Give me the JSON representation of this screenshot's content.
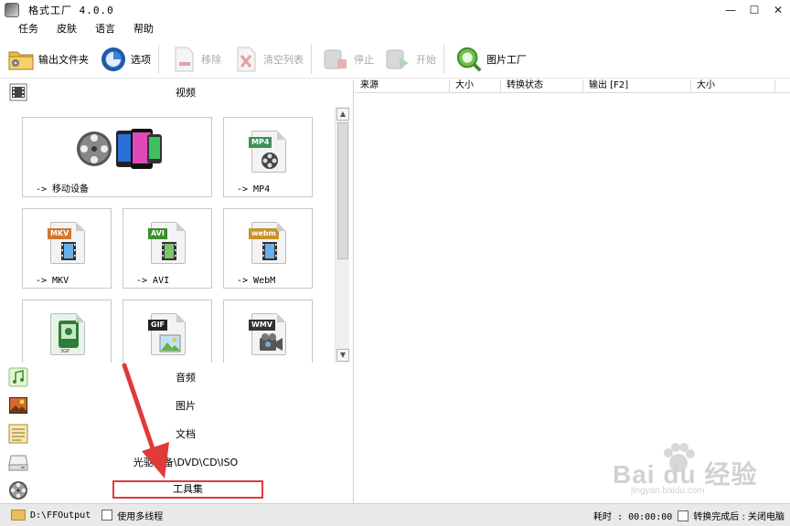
{
  "window": {
    "title": "格式工厂 4.0.0"
  },
  "menu": [
    "任务",
    "皮肤",
    "语言",
    "帮助"
  ],
  "toolbar": {
    "output_folder": "输出文件夹",
    "options": "选项",
    "remove": "移除",
    "clear_list": "清空列表",
    "stop": "停止",
    "start": "开始",
    "picture_factory": "图片工厂"
  },
  "left": {
    "video_header": "视频",
    "tiles": [
      {
        "label": "-> 移动设备"
      },
      {
        "label": "-> MP4",
        "badge": "MP4",
        "badge_color": "#3f8f5a"
      },
      {
        "label": "-> MKV",
        "badge": "MKV",
        "badge_color": "#d2782e"
      },
      {
        "label": "-> AVI",
        "badge": "AVI",
        "badge_color": "#3a8f2a"
      },
      {
        "label": "-> WebM",
        "badge": "webm",
        "badge_color": "#c8922e"
      },
      {
        "label": "",
        "badge": "3GP",
        "badge_color": "#2e7d3a"
      },
      {
        "label": "",
        "badge": "GIF",
        "badge_color": "#222222"
      },
      {
        "label": "",
        "badge": "WMV",
        "badge_color": "#333333"
      }
    ],
    "categories": [
      {
        "label": "音频",
        "icon": "music-note-icon"
      },
      {
        "label": "图片",
        "icon": "picture-icon"
      },
      {
        "label": "文档",
        "icon": "document-icon"
      },
      {
        "label": "光驱设备\\DVD\\CD\\ISO",
        "icon": "disc-drive-icon"
      },
      {
        "label": "工具集",
        "icon": "film-reel-icon",
        "highlighted": true
      }
    ]
  },
  "tasks": {
    "columns": [
      "来源",
      "大小",
      "转换状态",
      "输出 [F2]",
      "大小"
    ]
  },
  "status": {
    "output_path": "D:\\FFOutput",
    "multithread_label": "使用多线程",
    "elapsed_label": "耗时 : 00:00:00",
    "after_done_label": "转换完成后 : 关闭电脑"
  },
  "watermark": {
    "brand": "Bai du 经验",
    "sub": "jingyan.baidu.com"
  },
  "colors": {
    "highlight_box": "#e03a3a",
    "arrow": "#e03a3a"
  }
}
